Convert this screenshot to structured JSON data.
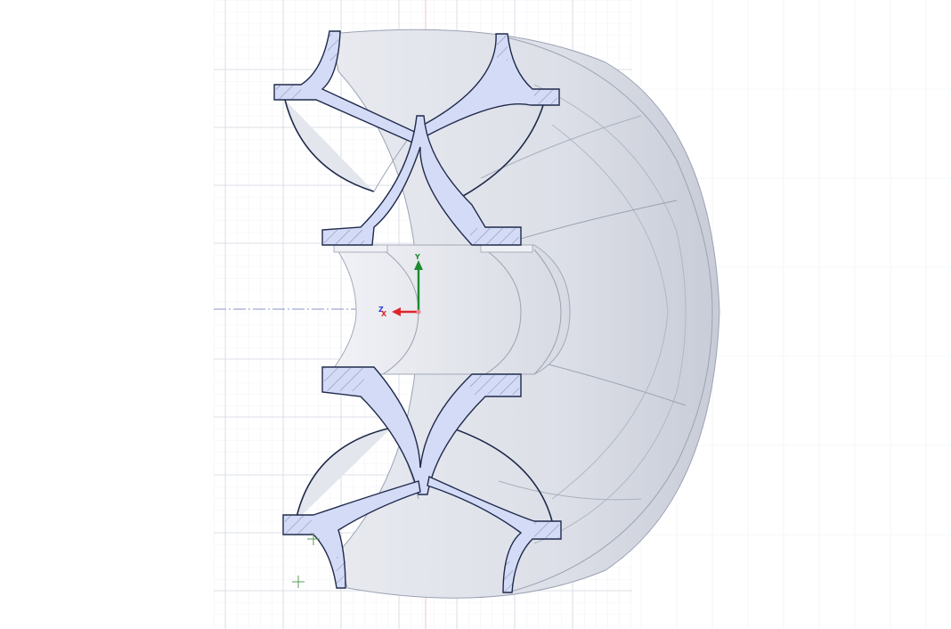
{
  "viewport": {
    "background": "#ffffff",
    "grid_minor_color": "#e3e7ee",
    "grid_major_color": "#cdd3dd",
    "part_fill": "#dfe2ea",
    "part_shade": "#c9cdd8",
    "section_fill": "#d4dbf7",
    "section_stroke": "#1f2a4a",
    "edge_color": "#8c93a5"
  },
  "triad": {
    "x_label": "X",
    "y_label": "Y",
    "z_label": "Z",
    "x_color": "#e0242b",
    "y_color": "#1d8a2e",
    "z_color": "#2d3ccf"
  },
  "cursor_markers": [
    "crosshair-icon",
    "crosshair-icon"
  ]
}
